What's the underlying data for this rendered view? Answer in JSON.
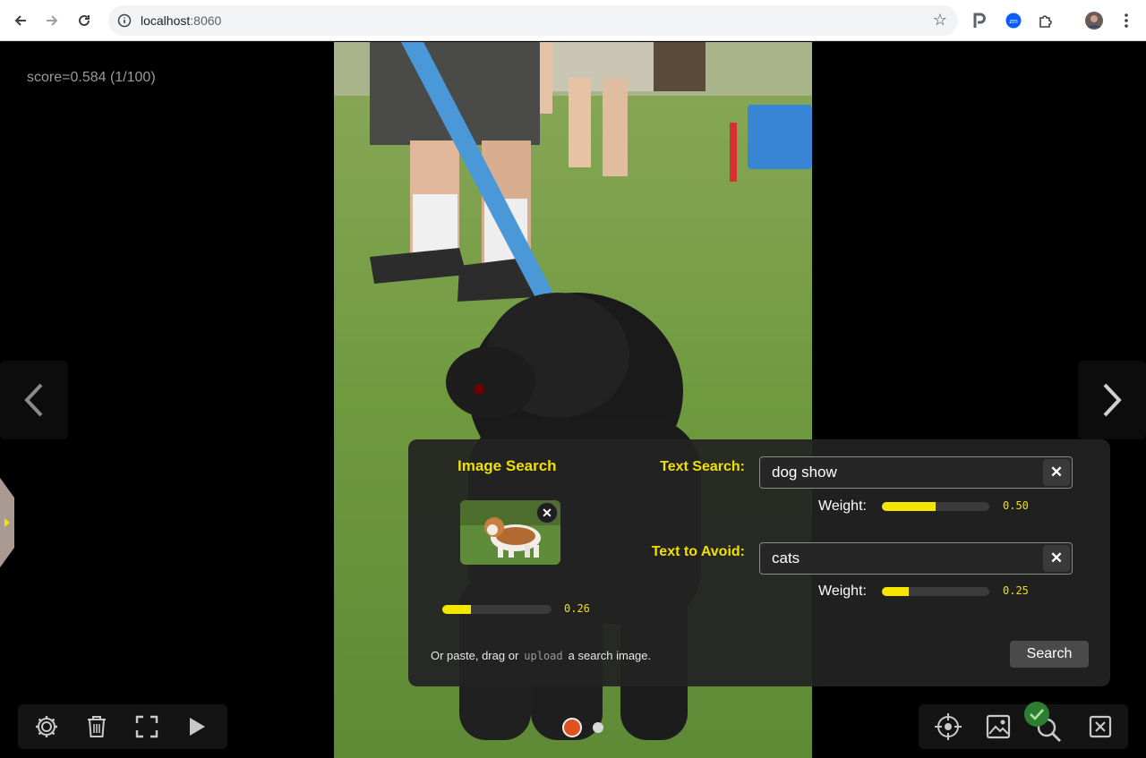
{
  "browser": {
    "url_host": "localhost",
    "url_port": ":8060",
    "icons": [
      "back-icon",
      "forward-icon",
      "reload-icon",
      "site-info-icon",
      "bookmark-star-icon",
      "extension-p-icon",
      "extension-zoom-icon",
      "extensions-puzzle-icon",
      "profile-avatar",
      "menu-dots-icon"
    ]
  },
  "viewer": {
    "score_text": "score=0.584 (1/100)"
  },
  "search_panel": {
    "image_search_title": "Image Search",
    "image_weight": 0.26,
    "image_weight_text": "0.26",
    "paste_prefix": "Or paste, drag or",
    "upload_link": "upload",
    "paste_suffix": "a search image.",
    "text_search_label": "Text Search:",
    "text_search_value": "dog show",
    "text_search_weight_label": "Weight:",
    "text_search_weight": 0.5,
    "text_search_weight_text": "0.50",
    "avoid_label": "Text to Avoid:",
    "avoid_value": "cats",
    "avoid_weight_label": "Weight:",
    "avoid_weight": 0.25,
    "avoid_weight_text": "0.25",
    "search_button": "Search",
    "clear_symbol": "✕"
  },
  "colors": {
    "accent_yellow": "#f0e000",
    "active_dot": "#e05020",
    "check_green": "#2e7d32"
  },
  "toolbar_left": [
    "gear-icon",
    "trash-icon",
    "fullscreen-icon",
    "play-icon"
  ],
  "toolbar_right": [
    "crosshair-icon",
    "image-icon",
    "search-magnifier-icon",
    "close-box-icon"
  ]
}
